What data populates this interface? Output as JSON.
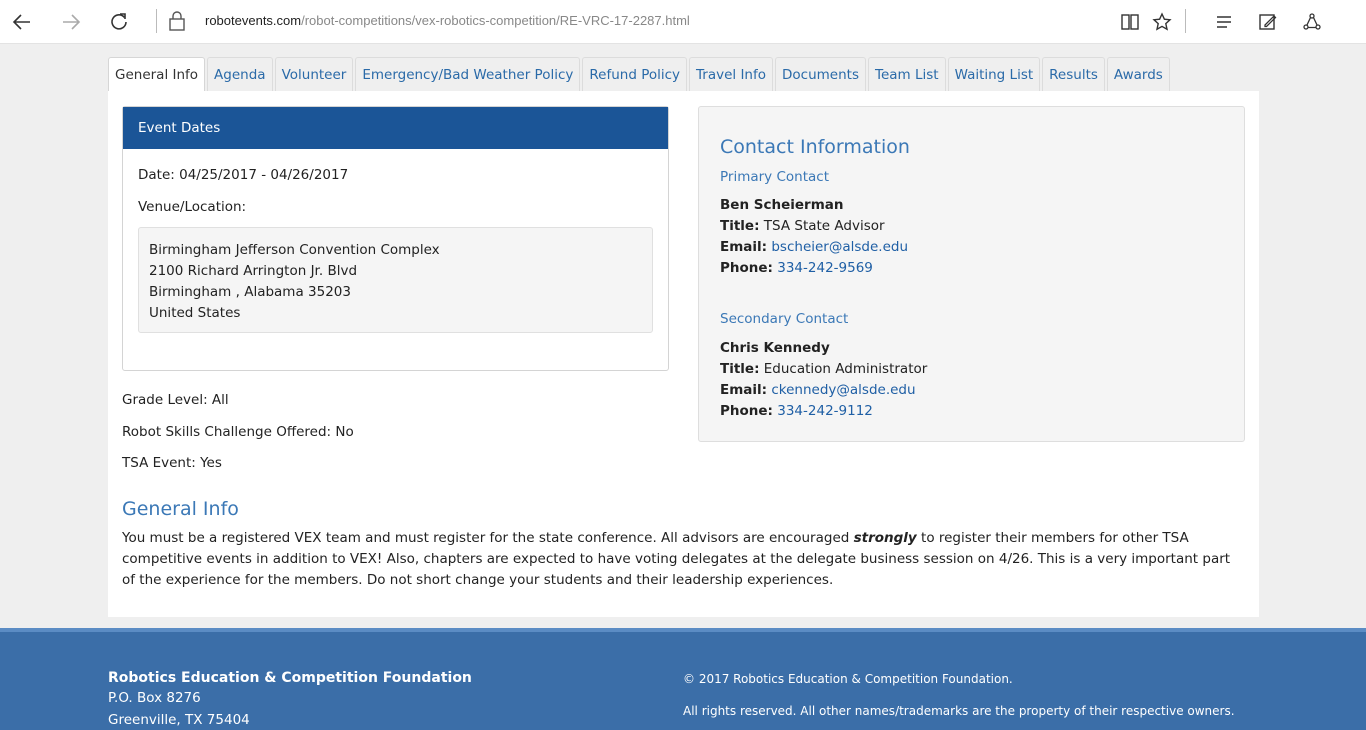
{
  "browser": {
    "url_host": "robotevents.com",
    "url_path": "/robot-competitions/vex-robotics-competition/RE-VRC-17-2287.html",
    "icons": [
      "back-icon",
      "forward-icon",
      "refresh-icon",
      "lock-icon",
      "reading-view-icon",
      "favorite-star-icon",
      "hub-icon",
      "web-note-icon",
      "share-icon"
    ]
  },
  "tabs": [
    {
      "label": "General Info"
    },
    {
      "label": "Agenda"
    },
    {
      "label": "Volunteer"
    },
    {
      "label": "Emergency/Bad Weather Policy"
    },
    {
      "label": "Refund Policy"
    },
    {
      "label": "Travel Info"
    },
    {
      "label": "Documents"
    },
    {
      "label": "Team List"
    },
    {
      "label": "Waiting List"
    },
    {
      "label": "Results"
    },
    {
      "label": "Awards"
    }
  ],
  "event_dates": {
    "header": "Event Dates",
    "date_line": "Date: 04/25/2017 - 04/26/2017",
    "venue_label": "Venue/Location:",
    "address": [
      "Birmingham Jefferson Convention Complex",
      "2100 Richard Arrington Jr. Blvd",
      "Birmingham , Alabama 35203",
      "United States"
    ]
  },
  "details": {
    "grade_level": "Grade Level: All",
    "skills_challenge": "Robot Skills Challenge Offered: No",
    "tsa_event": "TSA Event: Yes"
  },
  "contact": {
    "title": "Contact Information",
    "primary": {
      "heading": "Primary Contact",
      "name": "Ben Scheierman",
      "title_label": "Title:",
      "title_value": " TSA State Advisor",
      "email_label": "Email:",
      "email_value": "bscheier@alsde.edu",
      "phone_label": "Phone:",
      "phone_value": "334-242-9569"
    },
    "secondary": {
      "heading": "Secondary Contact",
      "name": "Chris Kennedy",
      "title_label": "Title:",
      "title_value": " Education Administrator",
      "email_label": "Email:",
      "email_value": "ckennedy@alsde.edu",
      "phone_label": "Phone:",
      "phone_value": "334-242-9112"
    }
  },
  "general_info": {
    "title": "General Info",
    "text_before": "You must be a registered VEX team and must register for the state conference.  All advisors are encouraged ",
    "text_emphasis": "strongly",
    "text_after": " to register their members for other TSA competitive events in addition to VEX! Also, chapters are expected to have voting delegates at the delegate business session on 4/26.  This is a very important part of the experience for the members.  Do not short change your students and their leadership experiences."
  },
  "footer": {
    "org": "Robotics Education & Competition Foundation",
    "po_box": "P.O. Box 8276",
    "city": "Greenville, TX 75404",
    "copyright": "© 2017 Robotics Education & Competition Foundation.",
    "rights": "All rights reserved. All other names/trademarks are the property of their respective owners."
  }
}
